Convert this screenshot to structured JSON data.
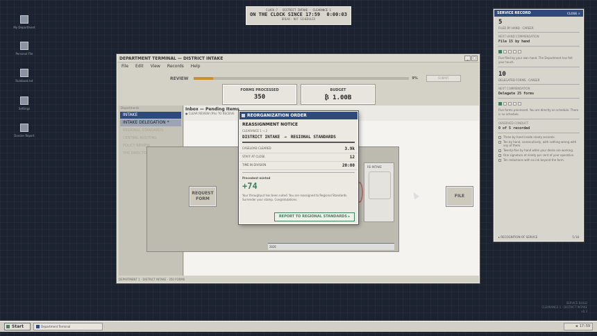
{
  "desktop": {
    "icons": [
      {
        "label": "My Department",
        "icon": "computer-icon"
      },
      {
        "label": "Personal File",
        "icon": "folder-icon"
      },
      {
        "label": "Rulebook.txt",
        "icon": "document-icon"
      },
      {
        "label": "Settings",
        "icon": "gear-icon"
      },
      {
        "label": "Dossier Report",
        "icon": "report-icon"
      }
    ]
  },
  "clock": {
    "line1": "CLOCK-7 · DISTRICT INTAKE · CLEARANCE 1",
    "on_the_clock": "ON THE CLOCK SINCE 17:59",
    "elapsed": "0:00:03",
    "line3": "BREAK: NOT SCHEDULED"
  },
  "window": {
    "title": "DEPARTMENT TERMINAL — DISTRICT INTAKE",
    "controls": [
      "_",
      "□"
    ],
    "menu": [
      "File",
      "Edit",
      "View",
      "Records",
      "Help"
    ],
    "review_label": "REVIEW",
    "review_progress": 0.09,
    "review_pct": "9%",
    "review_button": "SUBMIT",
    "stats": [
      {
        "title": "FORMS PROCESSED",
        "value": "350"
      },
      {
        "title": "BUDGET",
        "value": "₿ 1.00B"
      }
    ],
    "sidebar": {
      "heading": "Departments",
      "items": [
        {
          "label": "INTAKE",
          "state": "active"
        },
        {
          "label": "INTAKE DELEGATION *",
          "state": "sel"
        },
        {
          "label": "REGIONAL STANDARDS",
          "state": "ghost"
        },
        {
          "label": "CENTRAL AUDITING",
          "state": "ghost"
        },
        {
          "label": "POLICY REVIEW",
          "state": "ghost"
        },
        {
          "label": "THE DIRECTORATE",
          "state": "ghost"
        }
      ]
    },
    "inbox": {
      "header": "Inbox — Pending Items",
      "sub": "● CLEAR REVIEW (9%) TO RECEIVE"
    },
    "buttons": {
      "request": "REQUEST FORM",
      "file": "FILE"
    },
    "doc": {
      "tag": "RE-INTAKE",
      "bar_label": "2026"
    },
    "status": "DEPARTMENT 1 · DISTRICT INTAKE · 350 FORMS"
  },
  "modal": {
    "title": "REORGANIZATION ORDER",
    "notice": "REASSIGNMENT NOTICE",
    "clearance": "CLEARANCE 1 → 2",
    "from": "DISTRICT INTAKE",
    "arrow": "→",
    "to": "REGIONAL STANDARDS",
    "rows": [
      {
        "label": "CASELOAD CLEARED",
        "value": "3.9k"
      },
      {
        "label": "STAFF AT CLOSE",
        "value": "12"
      },
      {
        "label": "TIME IN DIVISION",
        "value": "20:00"
      }
    ],
    "precedent_label": "Precedent minted",
    "precedent_value": "+74",
    "text": "Your throughput has been noted. You are reassigned to Regional Standards. Surrender your stamp. Congratulations.",
    "button": "REPORT TO REGIONAL STANDARDS ▸"
  },
  "service_record": {
    "title": "SERVICE RECORD",
    "close": "CLOSE ×",
    "filed_count": "5",
    "filed_label": "FILED BY HAND · CAREER",
    "next_label": "NEXT HAND COMMENDATION",
    "next_value": "File 15 by hand",
    "boxes1": [
      true,
      false,
      false,
      false,
      false
    ],
    "para1": "Five filed by your own hand. The Department has felt your touch.",
    "deleg_count": "10",
    "deleg_label": "DELEGATED FORMS · CAREER",
    "next2_label": "NEXT COMMENDATION",
    "next2_value": "Delegate 25 forms",
    "boxes2": [
      true,
      false,
      false,
      false,
      false
    ],
    "para2": "Five forms processed. You are directly on schedule. There is no schedule.",
    "conduct_label": "OBSERVED CONDUCT",
    "conduct_value": "0 of 5 recorded",
    "conduct": [
      "Three by hand inside ninety seconds.",
      "Ten by hand, consecutively, with nothing wrong with any of them.",
      "Twenty-five by hand while your desks are working.",
      "One signature at ninety per cent of your operation.",
      "Ten redactions with no ink beyond the form."
    ],
    "footer_label": "▸ RECOGNITION OF SERVICE",
    "footer_value": "5/10"
  },
  "corner": {
    "line1": "SERVICE BUILD",
    "line2": "CLEARANCE 1 · DISTRICT INTAKE",
    "line3": "v0.3"
  },
  "taskbar": {
    "start": "Start",
    "task": "Department Terminal",
    "time": "17:59"
  }
}
